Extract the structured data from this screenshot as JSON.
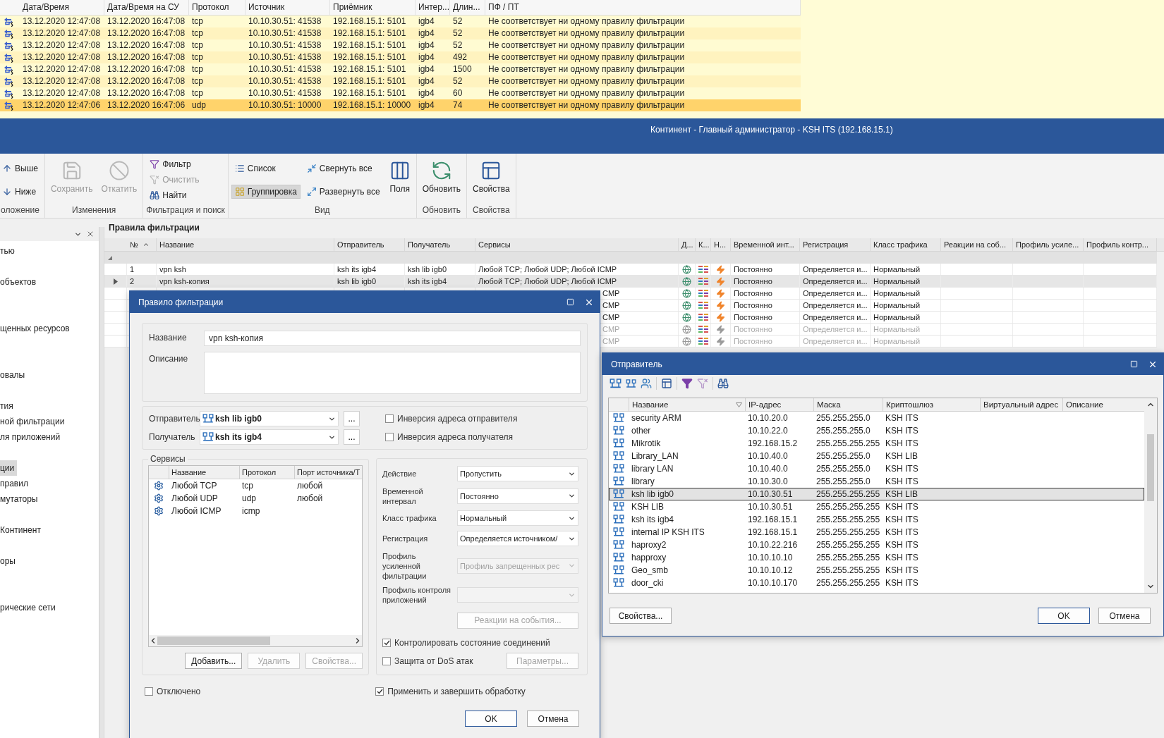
{
  "log": {
    "columns": [
      "Дата/Время",
      "Дата/Время на СУ",
      "Протокол",
      "Источник",
      "Приёмник",
      "Интер...",
      "Длин...",
      "ПФ / ПТ"
    ],
    "rows": [
      {
        "cells": [
          "13.12.2020 12:47:08",
          "13.12.2020 16:47:08",
          "tcp",
          "10.10.30.51: 41538",
          "192.168.15.1: 5101",
          "igb4",
          "52",
          "Не соответствует ни одному правилу фильтрации"
        ],
        "selected": false
      },
      {
        "cells": [
          "13.12.2020 12:47:08",
          "13.12.2020 16:47:08",
          "tcp",
          "10.10.30.51: 41538",
          "192.168.15.1: 5101",
          "igb4",
          "52",
          "Не соответствует ни одному правилу фильтрации"
        ],
        "selected": false
      },
      {
        "cells": [
          "13.12.2020 12:47:08",
          "13.12.2020 16:47:08",
          "tcp",
          "10.10.30.51: 41538",
          "192.168.15.1: 5101",
          "igb4",
          "52",
          "Не соответствует ни одному правилу фильтрации"
        ],
        "selected": false
      },
      {
        "cells": [
          "13.12.2020 12:47:08",
          "13.12.2020 16:47:08",
          "tcp",
          "10.10.30.51: 41538",
          "192.168.15.1: 5101",
          "igb4",
          "492",
          "Не соответствует ни одному правилу фильтрации"
        ],
        "selected": false
      },
      {
        "cells": [
          "13.12.2020 12:47:08",
          "13.12.2020 16:47:08",
          "tcp",
          "10.10.30.51: 41538",
          "192.168.15.1: 5101",
          "igb4",
          "1500",
          "Не соответствует ни одному правилу фильтрации"
        ],
        "selected": false
      },
      {
        "cells": [
          "13.12.2020 12:47:08",
          "13.12.2020 16:47:08",
          "tcp",
          "10.10.30.51: 41538",
          "192.168.15.1: 5101",
          "igb4",
          "52",
          "Не соответствует ни одному правилу фильтрации"
        ],
        "selected": false
      },
      {
        "cells": [
          "13.12.2020 12:47:08",
          "13.12.2020 16:47:08",
          "tcp",
          "10.10.30.51: 41538",
          "192.168.15.1: 5101",
          "igb4",
          "60",
          "Не соответствует ни одному правилу фильтрации"
        ],
        "selected": false
      },
      {
        "cells": [
          "13.12.2020 12:47:06",
          "13.12.2020 16:47:06",
          "udp",
          "10.10.30.51: 10000",
          "192.168.15.1: 10000",
          "igb4",
          "74",
          "Не соответствует ни одному правилу фильтрации"
        ],
        "selected": true
      }
    ]
  },
  "title": "Континент - Главный администратор - KSH ITS (192.168.15.1)",
  "ribbon": [
    {
      "label": "оложение",
      "items": [
        {
          "label": "Выше",
          "kind": "small",
          "disabled": false,
          "selected": false
        },
        {
          "label": "Ниже",
          "kind": "small",
          "disabled": false,
          "selected": false
        }
      ]
    },
    {
      "label": "Изменения",
      "items": [
        {
          "label": "Сохранить",
          "kind": "large",
          "disabled": true,
          "selected": false
        },
        {
          "label": "Откатить",
          "kind": "large",
          "disabled": true,
          "selected": false
        }
      ]
    },
    {
      "label": "Фильтрация и поиск",
      "items": [
        {
          "label": "Фильтр",
          "kind": "small",
          "disabled": false,
          "selected": false
        },
        {
          "label": "Очистить",
          "kind": "small",
          "disabled": true,
          "selected": false
        },
        {
          "label": "Найти",
          "kind": "small",
          "disabled": false,
          "selected": false
        }
      ]
    },
    {
      "label": "Вид",
      "items": [
        {
          "label": "Список",
          "kind": "small",
          "disabled": false,
          "selected": false
        },
        {
          "label": "Группировка",
          "kind": "small",
          "disabled": false,
          "selected": true
        },
        {
          "label": "Свернуть все",
          "kind": "small",
          "disabled": false,
          "selected": false
        },
        {
          "label": "Развернуть все",
          "kind": "small",
          "disabled": false,
          "selected": false
        },
        {
          "label": "Поля",
          "kind": "large",
          "disabled": false,
          "selected": false
        }
      ]
    },
    {
      "label": "Обновить",
      "items": [
        {
          "label": "Обновить",
          "kind": "large",
          "disabled": false,
          "selected": false
        }
      ]
    },
    {
      "label": "Свойства",
      "items": [
        {
          "label": "Свойства",
          "kind": "large",
          "disabled": false,
          "selected": false
        }
      ]
    }
  ],
  "sidebar": {
    "items": [
      {
        "label": "тью",
        "selected": false
      },
      {
        "label": "объектов",
        "selected": false
      },
      {
        "label": "щенных ресурсов",
        "selected": false
      },
      {
        "label": "овалы",
        "selected": false
      },
      {
        "label": "тия",
        "selected": false
      },
      {
        "label": "ной фильтрации",
        "selected": false
      },
      {
        "label": "ля приложений",
        "selected": false
      },
      {
        "label": "ции",
        "selected": true
      },
      {
        "label": "правил",
        "selected": false
      },
      {
        "label": "мутаторы",
        "selected": false
      },
      {
        "label": "Континент",
        "selected": false
      },
      {
        "label": "оры",
        "selected": false
      },
      {
        "label": "рические сети",
        "selected": false
      }
    ]
  },
  "rules": {
    "title": "Правила фильтрации",
    "columns": [
      "№",
      "Название",
      "Отправитель",
      "Получатель",
      "Сервисы",
      "Д...",
      "К...",
      "Н...",
      "Временной инт...",
      "Регистрация",
      "Класс трафика",
      "Реакции на соб...",
      "Профиль усиле...",
      "Профиль контр..."
    ],
    "rows": [
      {
        "number": "1",
        "name": "vpn ksh",
        "sender": "ksh its igb4",
        "receiver": "ksh lib igb0",
        "services": "Любой TCP; Любой UDP; Любой ICMP",
        "time": "Постоянно",
        "registration": "Определяется и...",
        "traffic_class": "Нормальный",
        "selected": false,
        "disabled": false
      },
      {
        "number": "2",
        "name": "vpn ksh-копия",
        "sender": "ksh lib igb0",
        "receiver": "ksh its igb4",
        "services": "Любой TCP; Любой UDP; Любой ICMP",
        "time": "Постоянно",
        "registration": "Определяется и...",
        "traffic_class": "Нормальный",
        "selected": true,
        "disabled": false
      },
      {
        "services": "CMP",
        "time": "Постоянно",
        "registration": "Определяется и...",
        "traffic_class": "Нормальный",
        "selected": false,
        "disabled": false
      },
      {
        "services": "CMP",
        "time": "Постоянно",
        "registration": "Определяется и...",
        "traffic_class": "Нормальный",
        "selected": false,
        "disabled": false
      },
      {
        "services": "CMP",
        "time": "Постоянно",
        "registration": "Определяется и...",
        "traffic_class": "Нормальный",
        "selected": false,
        "disabled": false
      },
      {
        "services": "CMP",
        "time": "Постоянно",
        "registration": "Определяется и...",
        "traffic_class": "Нормальный",
        "selected": false,
        "disabled": true
      },
      {
        "services": "CMP",
        "time": "Постоянно",
        "registration": "Определяется и...",
        "traffic_class": "Нормальный",
        "selected": false,
        "disabled": true
      }
    ]
  },
  "rule_dialog": {
    "title": "Правило фильтрации",
    "name": {
      "label": "Название",
      "value": "vpn ksh-копия"
    },
    "description": {
      "label": "Описание"
    },
    "sender": {
      "label": "Отправитель",
      "value": "ksh lib igb0",
      "browse": "...",
      "invert": {
        "label": "Инверсия адреса отправителя",
        "checked": false
      }
    },
    "receiver": {
      "label": "Получатель",
      "value": "ksh its igb4",
      "browse": "...",
      "invert": {
        "label": "Инверсия адреса получателя",
        "checked": false
      }
    },
    "services": {
      "title": "Сервисы",
      "columns": [
        "Название",
        "Протокол",
        "Порт источника/Т"
      ],
      "rows": [
        {
          "name": "Любой TCP",
          "protocol": "tcp",
          "port": "любой"
        },
        {
          "name": "Любой UDP",
          "protocol": "udp",
          "port": "любой"
        },
        {
          "name": "Любой ICMP",
          "protocol": "icmp"
        }
      ],
      "buttons": [
        {
          "label": "Добавить...",
          "disabled": false
        },
        {
          "label": "Удалить",
          "disabled": true
        },
        {
          "label": "Свойства...",
          "disabled": true
        }
      ]
    },
    "settings": [
      {
        "label": "Действие",
        "value": "Пропустить",
        "disabled": false
      },
      {
        "label": "Временной интервал",
        "value": "Постоянно",
        "disabled": false
      },
      {
        "label": "Класс трафика",
        "value": "Нормальный",
        "disabled": false
      },
      {
        "label": "Регистрация",
        "value": "Определяется источником/",
        "disabled": false
      },
      {
        "label": "Профиль усиленной фильтрации",
        "value": "Профиль запрещенных рес",
        "disabled": true
      },
      {
        "label": "Профиль контроля приложений",
        "disabled": true
      }
    ],
    "events_button": {
      "label": "Реакции на события...",
      "disabled": true
    },
    "track_state": {
      "label": "Контролировать состояние соединений",
      "checked": true
    },
    "dos": {
      "label": "Защита от DoS атак",
      "checked": false
    },
    "params_button": {
      "label": "Параметры...",
      "disabled": true
    },
    "disabled_rule": {
      "label": "Отключено",
      "checked": false
    },
    "apply": {
      "label": "Применить и завершить обработку",
      "checked": true
    },
    "buttons": [
      {
        "label": "OK",
        "default": true
      },
      {
        "label": "Отмена",
        "default": false
      }
    ]
  },
  "sender_dialog": {
    "title": "Отправитель",
    "columns": [
      "Название",
      "IP-адрес",
      "Маска",
      "Криптошлюз",
      "Виртуальный адрес",
      "Описание"
    ],
    "rows": [
      {
        "name": "security ARM",
        "ip": "10.10.20.0",
        "mask": "255.255.255.0",
        "gateway": "KSH ITS",
        "selected": false
      },
      {
        "name": "other",
        "ip": "10.10.22.0",
        "mask": "255.255.255.0",
        "gateway": "KSH ITS",
        "selected": false
      },
      {
        "name": "Mikrotik",
        "ip": "192.168.15.2",
        "mask": "255.255.255.255",
        "gateway": "KSH ITS",
        "selected": false
      },
      {
        "name": "Library_LAN",
        "ip": "10.10.40.0",
        "mask": "255.255.255.0",
        "gateway": "KSH LIB",
        "selected": false
      },
      {
        "name": "library LAN",
        "ip": "10.10.40.0",
        "mask": "255.255.255.0",
        "gateway": "KSH ITS",
        "selected": false
      },
      {
        "name": "library",
        "ip": "10.10.30.0",
        "mask": "255.255.255.0",
        "gateway": "KSH ITS",
        "selected": false
      },
      {
        "name": "ksh lib igb0",
        "ip": "10.10.30.51",
        "mask": "255.255.255.255",
        "gateway": "KSH LIB",
        "selected": true
      },
      {
        "name": "KSH LIB",
        "ip": "10.10.30.51",
        "mask": "255.255.255.255",
        "gateway": "KSH ITS",
        "selected": false
      },
      {
        "name": "ksh its igb4",
        "ip": "192.168.15.1",
        "mask": "255.255.255.255",
        "gateway": "KSH ITS",
        "selected": false
      },
      {
        "name": "internal IP KSH ITS",
        "ip": "192.168.15.1",
        "mask": "255.255.255.255",
        "gateway": "KSH ITS",
        "selected": false
      },
      {
        "name": "haproxy2",
        "ip": "10.10.22.216",
        "mask": "255.255.255.255",
        "gateway": "KSH ITS",
        "selected": false
      },
      {
        "name": "happroxy",
        "ip": "10.10.10.10",
        "mask": "255.255.255.255",
        "gateway": "KSH ITS",
        "selected": false
      },
      {
        "name": "Geo_smb",
        "ip": "10.10.10.12",
        "mask": "255.255.255.255",
        "gateway": "KSH ITS",
        "selected": false
      },
      {
        "name": "door_cki",
        "ip": "10.10.10.170",
        "mask": "255.255.255.255",
        "gateway": "KSH ITS",
        "selected": false
      }
    ],
    "buttons": [
      {
        "label": "Свойства...",
        "default": false
      },
      {
        "label": "OK",
        "default": true
      },
      {
        "label": "Отмена",
        "default": false
      }
    ]
  }
}
